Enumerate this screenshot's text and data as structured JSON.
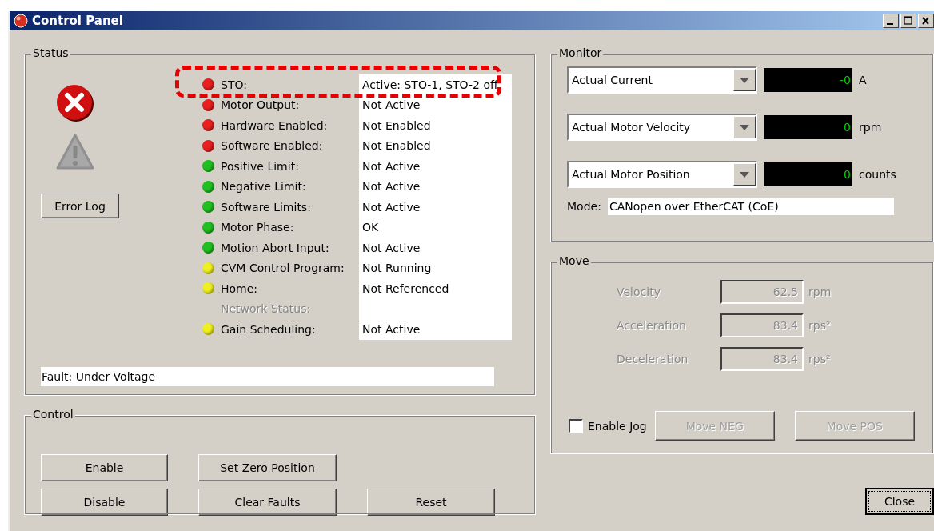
{
  "window": {
    "title": "Control Panel"
  },
  "status": {
    "title": "Status",
    "error_button": "Error Log",
    "items": [
      {
        "label": "STO:",
        "value": "Active: STO-1, STO-2 off",
        "color": "#e82020",
        "disabled": false,
        "highlighted": true
      },
      {
        "label": "Motor Output:",
        "value": "Not Active",
        "color": "#e82020",
        "disabled": false,
        "highlighted": false
      },
      {
        "label": "Hardware Enabled:",
        "value": "Not Enabled",
        "color": "#e82020",
        "disabled": false,
        "highlighted": false
      },
      {
        "label": "Software Enabled:",
        "value": "Not Enabled",
        "color": "#e82020",
        "disabled": false,
        "highlighted": false
      },
      {
        "label": "Positive Limit:",
        "value": "Not Active",
        "color": "#20c020",
        "disabled": false,
        "highlighted": false
      },
      {
        "label": "Negative Limit:",
        "value": "Not Active",
        "color": "#20c020",
        "disabled": false,
        "highlighted": false
      },
      {
        "label": "Software Limits:",
        "value": "Not Active",
        "color": "#20c020",
        "disabled": false,
        "highlighted": false
      },
      {
        "label": "Motor Phase:",
        "value": "OK",
        "color": "#20c020",
        "disabled": false,
        "highlighted": false
      },
      {
        "label": "Motion Abort Input:",
        "value": "Not Active",
        "color": "#20c020",
        "disabled": false,
        "highlighted": false
      },
      {
        "label": "CVM Control Program:",
        "value": "Not Running",
        "color": "#f0f020",
        "disabled": false,
        "highlighted": false
      },
      {
        "label": "Home:",
        "value": "Not Referenced",
        "color": "#f0f020",
        "disabled": false,
        "highlighted": false
      },
      {
        "label": "Network Status:",
        "disabled": true,
        "highlighted": false
      },
      {
        "label": "Gain Scheduling:",
        "value": "Not Active",
        "color": "#f0f020",
        "disabled": false,
        "highlighted": false
      }
    ],
    "fault": "Fault:  Under Voltage"
  },
  "control": {
    "title": "Control",
    "buttons": [
      "Enable",
      "Set Zero Position",
      "Disable",
      "Clear Faults",
      "Reset"
    ]
  },
  "monitor": {
    "title": "Monitor",
    "channels": [
      {
        "select": "Actual Current",
        "reading": "-0",
        "unit": "A"
      },
      {
        "select": "Actual Motor Velocity",
        "reading": "0",
        "unit": "rpm"
      },
      {
        "select": "Actual Motor Position",
        "reading": "0",
        "unit": "counts"
      }
    ],
    "mode_label": "Mode:",
    "mode": "CANopen over EtherCAT (CoE)"
  },
  "move": {
    "title": "Move",
    "disabled": true,
    "fields": [
      {
        "label": "Velocity",
        "value": "62.5",
        "unit": "rpm"
      },
      {
        "label": "Acceleration",
        "value": "83.4",
        "unit": "rps²"
      },
      {
        "label": "Deceleration",
        "value": "83.4",
        "unit": "rps²"
      }
    ],
    "jog": {
      "label": "Enable Jog",
      "checked": false
    },
    "buttons": [
      "Move NEG",
      "Move POS"
    ]
  },
  "close_button": {
    "label": "Close",
    "focused": true
  }
}
